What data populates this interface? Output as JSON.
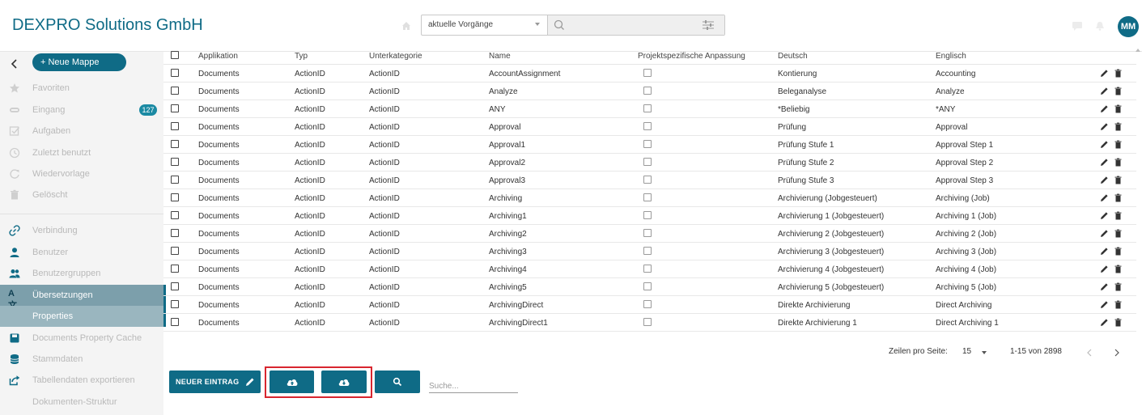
{
  "header": {
    "brand": "DEXPRO Solutions GmbH",
    "search_scope": "aktuelle Vorgänge",
    "avatar_initials": "MM"
  },
  "sidebar": {
    "new_folder_label": "+ Neue Mappe",
    "items": [
      {
        "label": "Favoriten",
        "icon": "star-icon"
      },
      {
        "label": "Eingang",
        "icon": "inbox-icon",
        "badge": "127"
      },
      {
        "label": "Aufgaben",
        "icon": "tasks-icon"
      },
      {
        "label": "Zuletzt benutzt",
        "icon": "clock-icon"
      },
      {
        "label": "Wiedervorlage",
        "icon": "refresh-icon"
      },
      {
        "label": "Gelöscht",
        "icon": "trash-icon"
      },
      {
        "label": "Verbindung",
        "icon": "link-icon"
      },
      {
        "label": "Benutzer",
        "icon": "user-icon"
      },
      {
        "label": "Benutzergruppen",
        "icon": "users-icon"
      },
      {
        "label": "Übersetzungen",
        "icon": "translate-icon"
      },
      {
        "label": "Properties",
        "icon": ""
      },
      {
        "label": "Documents Property Cache",
        "icon": "save-icon"
      },
      {
        "label": "Stammdaten",
        "icon": "database-icon"
      },
      {
        "label": "Tabellendaten exportieren",
        "icon": "export-icon"
      },
      {
        "label": "Dokumenten-Struktur",
        "icon": ""
      }
    ]
  },
  "table": {
    "columns": [
      "Applikation",
      "Typ",
      "Unterkategorie",
      "Name",
      "Projektspezifische Anpassung",
      "Deutsch",
      "Englisch"
    ],
    "rows": [
      [
        "Documents",
        "ActionID",
        "ActionID",
        "AccountAssignment",
        "Kontierung",
        "Accounting"
      ],
      [
        "Documents",
        "ActionID",
        "ActionID",
        "Analyze",
        "Beleganalyse",
        "Analyze"
      ],
      [
        "Documents",
        "ActionID",
        "ActionID",
        "ANY",
        "*Beliebig",
        "*ANY"
      ],
      [
        "Documents",
        "ActionID",
        "ActionID",
        "Approval",
        "Prüfung",
        "Approval"
      ],
      [
        "Documents",
        "ActionID",
        "ActionID",
        "Approval1",
        "Prüfung Stufe 1",
        "Approval Step 1"
      ],
      [
        "Documents",
        "ActionID",
        "ActionID",
        "Approval2",
        "Prüfung Stufe 2",
        "Approval Step 2"
      ],
      [
        "Documents",
        "ActionID",
        "ActionID",
        "Approval3",
        "Prüfung Stufe 3",
        "Approval Step 3"
      ],
      [
        "Documents",
        "ActionID",
        "ActionID",
        "Archiving",
        "Archivierung (Jobgesteuert)",
        "Archiving (Job)"
      ],
      [
        "Documents",
        "ActionID",
        "ActionID",
        "Archiving1",
        "Archivierung 1 (Jobgesteuert)",
        "Archiving 1 (Job)"
      ],
      [
        "Documents",
        "ActionID",
        "ActionID",
        "Archiving2",
        "Archivierung 2 (Jobgesteuert)",
        "Archiving 2 (Job)"
      ],
      [
        "Documents",
        "ActionID",
        "ActionID",
        "Archiving3",
        "Archivierung 3 (Jobgesteuert)",
        "Archiving 3 (Job)"
      ],
      [
        "Documents",
        "ActionID",
        "ActionID",
        "Archiving4",
        "Archivierung 4 (Jobgesteuert)",
        "Archiving 4 (Job)"
      ],
      [
        "Documents",
        "ActionID",
        "ActionID",
        "Archiving5",
        "Archivierung 5 (Jobgesteuert)",
        "Archiving 5 (Job)"
      ],
      [
        "Documents",
        "ActionID",
        "ActionID",
        "ArchivingDirect",
        "Direkte Archivierung",
        "Direct Archiving"
      ],
      [
        "Documents",
        "ActionID",
        "ActionID",
        "ArchivingDirect1",
        "Direkte Archivierung 1",
        "Direct Archiving 1"
      ]
    ]
  },
  "pagination": {
    "rows_per_page_label": "Zeilen pro Seite:",
    "rows_per_page": "15",
    "range": "1-15 von 2898"
  },
  "toolbar": {
    "new_entry_label": "NEUER EINTRAG",
    "search_placeholder": "Suche..."
  },
  "colors": {
    "accent": "#0f6b86",
    "highlight": "#d8262f"
  }
}
